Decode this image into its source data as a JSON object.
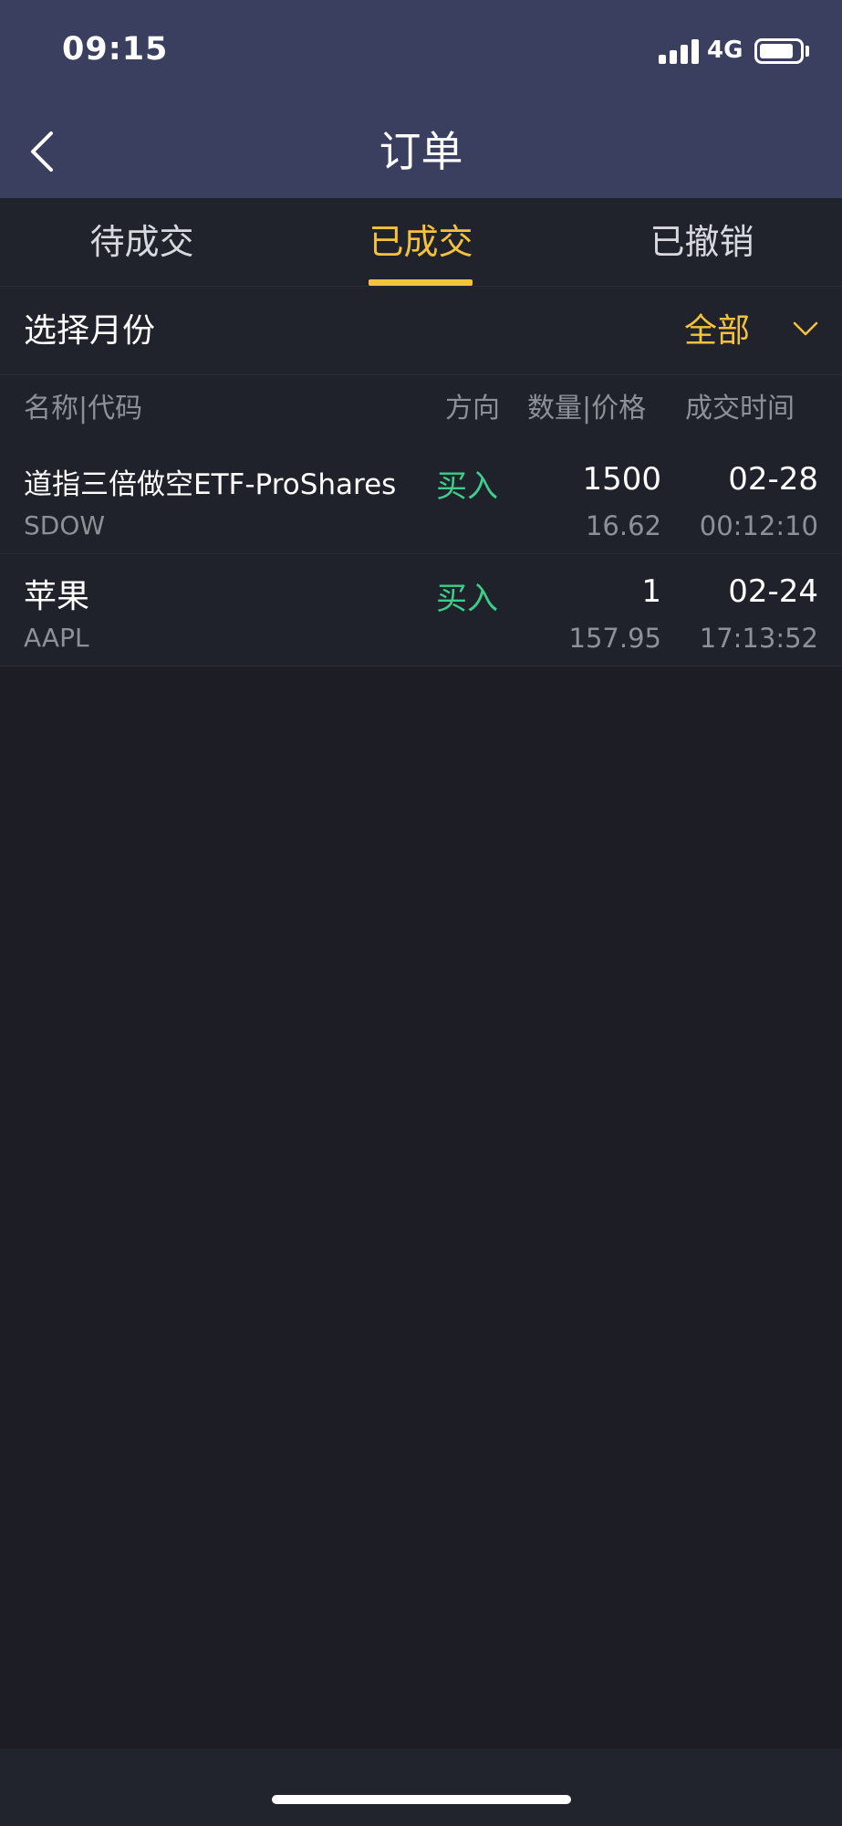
{
  "status_bar": {
    "time": "09:15",
    "network": "4G",
    "battery_level": 0.85,
    "signal_icon": "signal-bars-icon",
    "battery_icon": "battery-icon"
  },
  "header": {
    "title": "订单",
    "back_icon": "chevron-left-icon"
  },
  "tabs": [
    {
      "label": "待成交",
      "active": false
    },
    {
      "label": "已成交",
      "active": true
    },
    {
      "label": "已撤销",
      "active": false
    }
  ],
  "filter": {
    "label": "选择月份",
    "value": "全部",
    "dropdown_icon": "chevron-down-icon"
  },
  "table": {
    "columns": {
      "name_code": "名称|代码",
      "direction": "方向",
      "qty_price": "数量|价格",
      "time": "成交时间"
    },
    "rows": [
      {
        "name": "道指三倍做空ETF-ProShares",
        "code": "SDOW",
        "direction": "买入",
        "quantity": "1500",
        "price": "16.62",
        "date": "02-28",
        "time": "00:12:10"
      },
      {
        "name": "苹果",
        "code": "AAPL",
        "direction": "买入",
        "quantity": "1",
        "price": "157.95",
        "date": "02-24",
        "time": "17:13:52"
      }
    ]
  },
  "colors": {
    "header_bg": "#3a3f5f",
    "page_bg": "#1c1d25",
    "accent": "#f5c33b",
    "buy": "#3dce8a",
    "muted_text": "#8e9098"
  }
}
